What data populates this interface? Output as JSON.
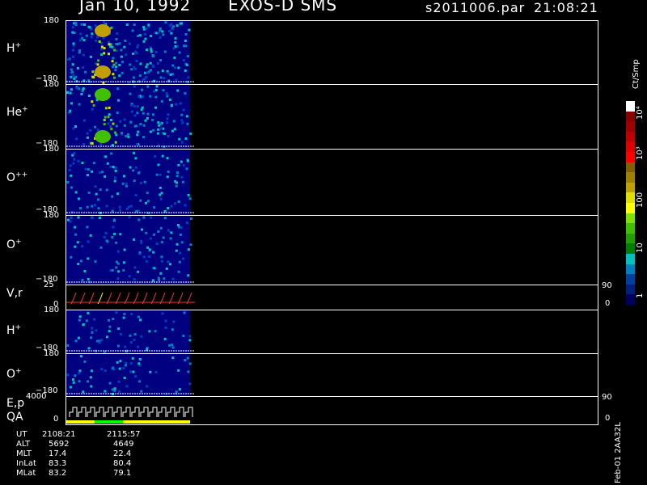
{
  "header": {
    "date": "Jan 10, 1992",
    "instrument": "EXOS-D SMS",
    "file": "s2011006.par",
    "time": "21:08:21"
  },
  "panels": [
    {
      "id": "h-plus-1",
      "label_main": "H",
      "label_sup": "+",
      "y_top": "180",
      "y_bottom": "−180"
    },
    {
      "id": "he-plus",
      "label_main": "He",
      "label_sup": "+",
      "y_top": "180",
      "y_bottom": "−180"
    },
    {
      "id": "o-plusplus",
      "label_main": "O",
      "label_sup": "++",
      "y_top": "180",
      "y_bottom": "−180"
    },
    {
      "id": "o-plus-1",
      "label_main": "O",
      "label_sup": "+",
      "y_top": "180",
      "y_bottom": "−180"
    },
    {
      "id": "vr",
      "label_main": "V,r",
      "label_sup": "",
      "y_top": "25",
      "y_bottom": "0",
      "right_top": "90",
      "right_bottom": "0"
    },
    {
      "id": "h-plus-2",
      "label_main": "H",
      "label_sup": "+",
      "y_top": "180",
      "y_bottom": "−180"
    },
    {
      "id": "o-plus-2",
      "label_main": "O",
      "label_sup": "+",
      "y_top": "180",
      "y_bottom": "−180"
    },
    {
      "id": "ep-qa",
      "label_main": "E,p",
      "label_sub2": "QA",
      "label_sup": "",
      "y_top": "4000",
      "y_bottom": "0",
      "right_top": "90",
      "right_bottom": "0"
    }
  ],
  "colorbar": {
    "unit": "Ct/Smp",
    "ticks": [
      "10⁴",
      "10³",
      "100",
      "10",
      "1"
    ],
    "colors": [
      "#ffffff",
      "#8b0000",
      "#a00000",
      "#c00000",
      "#e00000",
      "#ff0000",
      "#806000",
      "#a08000",
      "#c0a000",
      "#e0e000",
      "#ffff00",
      "#80e000",
      "#40c000",
      "#20a000",
      "#008000",
      "#00c0c0",
      "#0080c0",
      "#0040a0",
      "#002080",
      "#000060"
    ]
  },
  "ephemeris": {
    "rows": [
      {
        "label": "UT",
        "v1": "2108:21",
        "v2": "2115:57"
      },
      {
        "label": "ALT",
        "v1": "5692",
        "v2": "4649"
      },
      {
        "label": "MLT",
        "v1": "17.4",
        "v2": "22.4"
      },
      {
        "label": "InLat",
        "v1": "83.3",
        "v2": "80.4"
      },
      {
        "label": "MLat",
        "v1": "83.2",
        "v2": "79.1"
      }
    ]
  },
  "footer": {
    "stamp": "Feb-01 2AA32L"
  },
  "chart_data": {
    "type": "heatmap",
    "title": "Jan 10, 1992   EXOS-D SMS",
    "x": [
      "2108:21",
      "2115:57"
    ],
    "panels": [
      {
        "name": "H+",
        "ylim": [
          -180,
          180
        ]
      },
      {
        "name": "He+",
        "ylim": [
          -180,
          180
        ]
      },
      {
        "name": "O++",
        "ylim": [
          -180,
          180
        ]
      },
      {
        "name": "O+",
        "ylim": [
          -180,
          180
        ]
      },
      {
        "name": "V,r",
        "ylim": [
          0,
          25
        ],
        "right_ylim": [
          0,
          90
        ]
      },
      {
        "name": "H+",
        "ylim": [
          -180,
          180
        ]
      },
      {
        "name": "O+",
        "ylim": [
          -180,
          180
        ]
      },
      {
        "name": "E,p QA",
        "ylim": [
          0,
          4000
        ],
        "right_ylim": [
          0,
          90
        ]
      }
    ],
    "colorbar": {
      "unit": "Ct/Smp",
      "scale": "log",
      "range": [
        1,
        10000
      ]
    },
    "qa_segments": [
      {
        "from": 0.0,
        "to": 0.23,
        "color": "#ffff00"
      },
      {
        "from": 0.23,
        "to": 0.46,
        "color": "#00ff00"
      },
      {
        "from": 0.46,
        "to": 1.0,
        "color": "#ffff00"
      }
    ]
  }
}
